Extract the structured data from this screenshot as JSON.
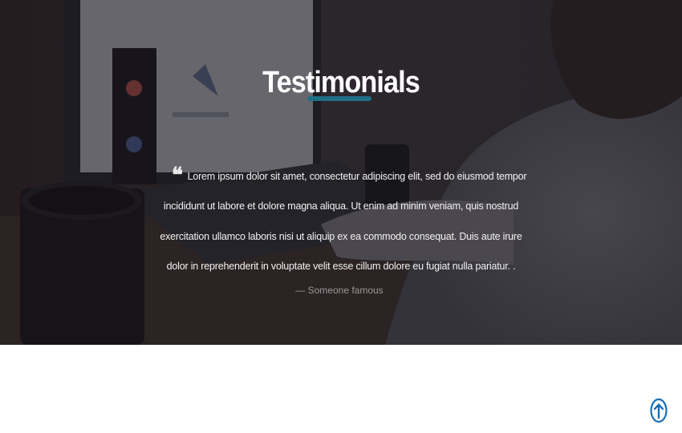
{
  "testimonials": {
    "title": "Testimonials",
    "accent_color": "#1f6f86",
    "quote_icon": "quote-left-icon",
    "quote_icon_glyph": "❝",
    "quote_lines": [
      "Lorem ipsum dolor sit amet, consectetur adipiscing elit, sed do eiusmod tempor",
      "incididunt ut labore et dolore magna aliqua. Ut enim ad minim veniam, quis nostrud",
      "exercitation ullamco laboris nisi ut aliquip ex ea commodo consequat. Duis aute irure",
      "dolor in reprehenderit in voluptate velit esse cillum dolore eu fugiat nulla pariatur. ."
    ],
    "author": "— Someone famous"
  },
  "scroll_top": {
    "icon": "arrow-up-circle-icon",
    "color": "#1a6fb5"
  }
}
